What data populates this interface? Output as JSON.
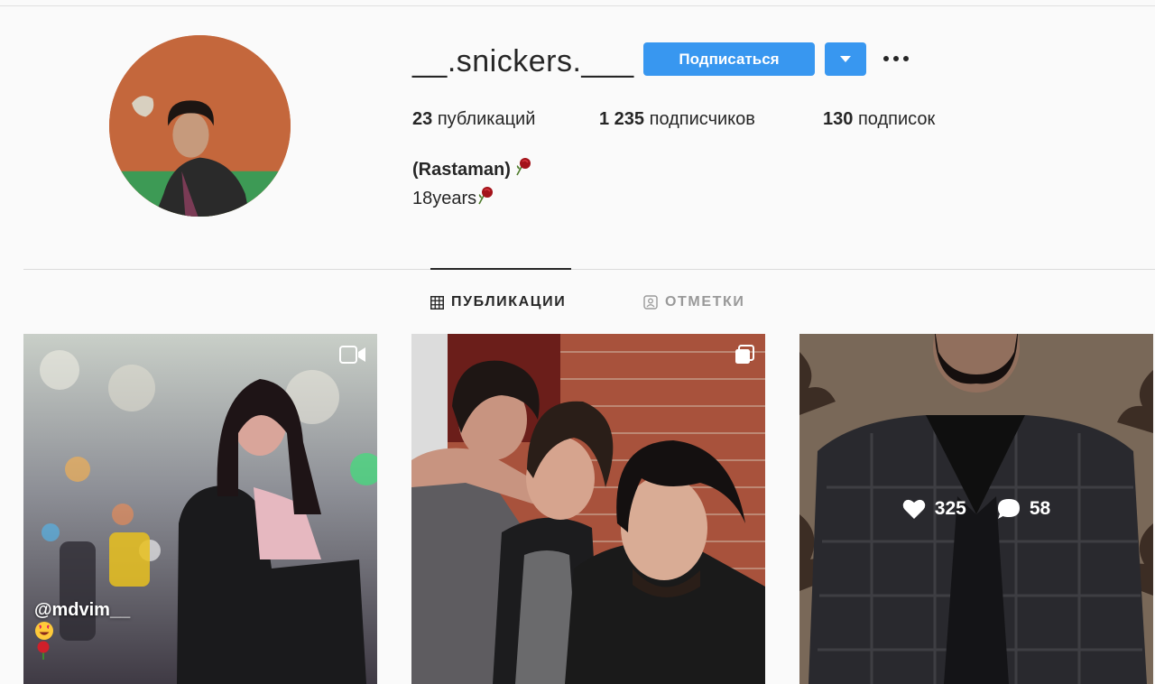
{
  "profile": {
    "username": "__.snickers.___",
    "follow_label": "Подписаться",
    "stats": {
      "posts_count": "23",
      "posts_label": "публикаций",
      "followers_count": "1 235",
      "followers_label": "подписчиков",
      "following_count": "130",
      "following_label": "подписок"
    },
    "full_name": "(Rastaman)",
    "bio": "18years"
  },
  "tabs": [
    {
      "label": "ПУБЛИКАЦИИ",
      "icon": "grid-icon",
      "active": true
    },
    {
      "label": "ОТМЕТКИ",
      "icon": "tagged-icon",
      "active": false
    }
  ],
  "posts": [
    {
      "type": "video",
      "caption": "@mdvim__"
    },
    {
      "type": "carousel"
    },
    {
      "type": "photo",
      "likes": "325",
      "comments": "58"
    }
  ],
  "colors": {
    "accent": "#3897f0",
    "text": "#262626",
    "muted": "#999999",
    "background": "#fafafa"
  }
}
